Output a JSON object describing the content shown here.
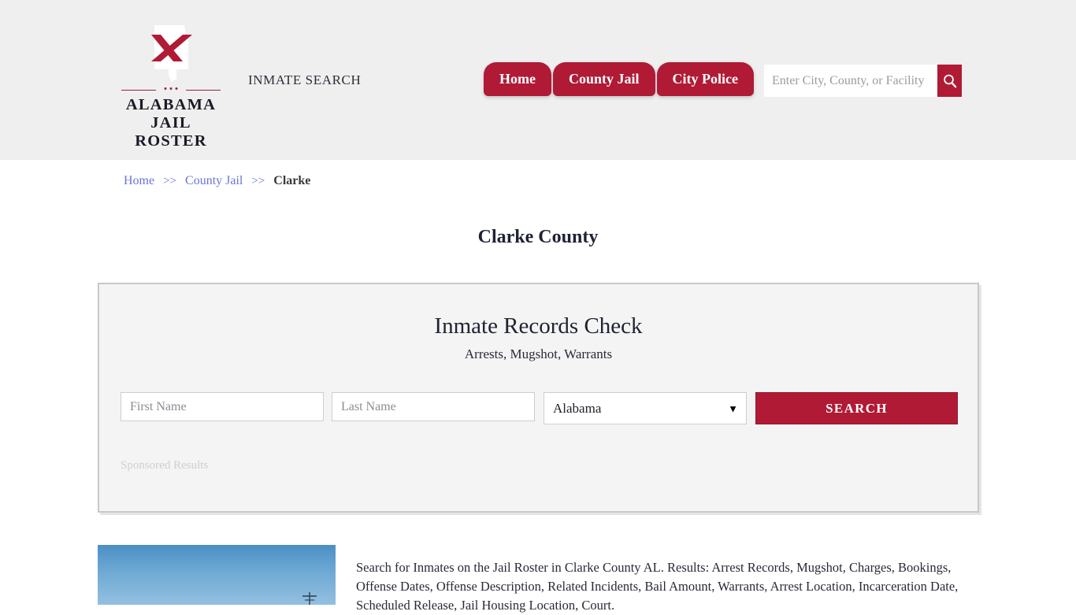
{
  "header": {
    "logo": {
      "line1": "ALABAMA",
      "line2": "JAIL ROSTER",
      "mark_icon": "alabama-state-outline-with-cross-icon"
    },
    "tagline": "INMATE SEARCH",
    "nav": [
      {
        "label": "Home"
      },
      {
        "label": "County Jail"
      },
      {
        "label": "City Police"
      }
    ],
    "search": {
      "placeholder": "Enter City, County, or Facility",
      "value": "",
      "button_icon": "search-icon"
    },
    "background_color": "#efefef"
  },
  "breadcrumb": {
    "items": [
      {
        "label": "Home",
        "link": true
      },
      {
        "label": "County Jail",
        "link": true
      },
      {
        "label": "Clarke",
        "link": false
      }
    ],
    "separator": ">>"
  },
  "page": {
    "title": "Clarke County"
  },
  "records_card": {
    "title": "Inmate Records Check",
    "subtitle": "Arrests, Mugshot, Warrants",
    "form": {
      "first_name_placeholder": "First Name",
      "first_name_value": "",
      "last_name_placeholder": "Last Name",
      "last_name_value": "",
      "state_selected": "Alabama",
      "state_options": [
        "Alabama"
      ],
      "state_chevron_icon": "chevron-down-icon",
      "submit_label": "SEARCH"
    },
    "sponsored_label": "Sponsored Results"
  },
  "bottom": {
    "photo_alt": "jail-facility-photo",
    "description": "Search for Inmates on the Jail Roster in Clarke County AL. Results: Arrest Records, Mugshot, Charges, Bookings, Offense Dates, Offense Description, Related Incidents, Bail Amount, Warrants, Arrest Location, Incarceration Date, Scheduled Release, Jail Housing Location, Court."
  },
  "colors": {
    "accent": "#b01a35",
    "link": "#6c74d8",
    "header_bg": "#efefef",
    "card_bg": "#f4f4f4",
    "card_border": "#c9c9c9"
  }
}
